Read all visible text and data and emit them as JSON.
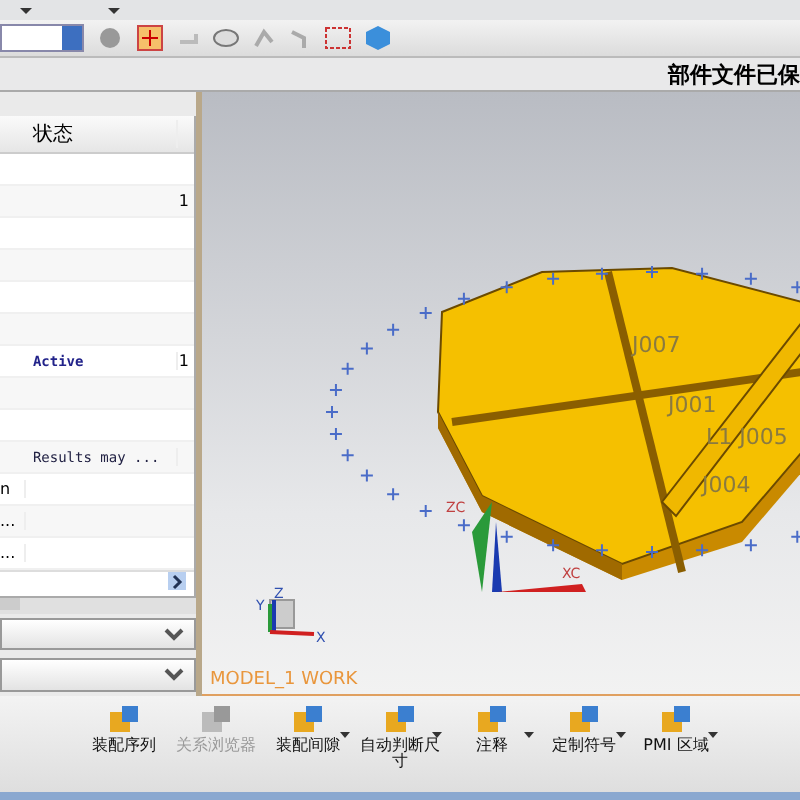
{
  "status_message": "部件文件已保",
  "navigator": {
    "column_header": "状态",
    "rows": [
      {},
      {
        "column_3": "1"
      },
      {},
      {},
      {},
      {},
      {
        "status": "Active",
        "column_3": "1"
      },
      {},
      {},
      {
        "status": "Results may ..."
      },
      {
        "column_1": "n"
      },
      {
        "column_1": "..."
      },
      {
        "column_1": "..."
      }
    ]
  },
  "viewport": {
    "label": "MODEL_1 WORK",
    "part_labels": [
      "J007",
      "J001",
      "L1 J005",
      "J004"
    ],
    "axis_labels": [
      "ZC",
      "XC"
    ],
    "triad_labels": [
      "Y",
      "Z",
      "X"
    ]
  },
  "ribbon": [
    {
      "label": "装配序列",
      "disabled": false,
      "dropdown": false
    },
    {
      "label": "关系浏览器",
      "disabled": true,
      "dropdown": false
    },
    {
      "label": "装配间隙",
      "disabled": false,
      "dropdown": true
    },
    {
      "label": "自动判断尺寸",
      "disabled": false,
      "dropdown": true
    },
    {
      "label": "注释",
      "disabled": false,
      "dropdown": true
    },
    {
      "label": "定制符号",
      "disabled": false,
      "dropdown": true
    },
    {
      "label": "PMI 区域",
      "disabled": false,
      "dropdown": true
    }
  ]
}
